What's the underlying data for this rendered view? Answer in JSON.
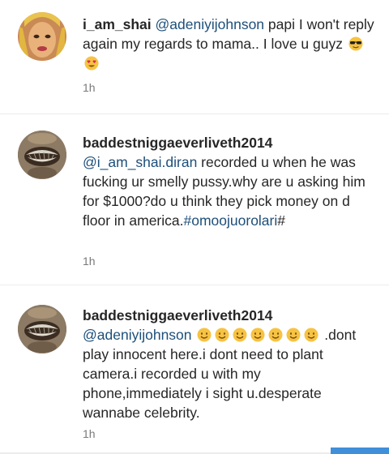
{
  "comments": [
    {
      "username": "i_am_shai",
      "mention": "@adeniyijohnson",
      "text": " papi I won't reply again my regards to mama.. I love u guyz ",
      "emojis": [
        "sunglasses-face-icon",
        "heart-eyes-face-icon"
      ],
      "time": "1h"
    },
    {
      "username": "baddestniggaeverliveth2014",
      "mention": "@i_am_shai.diran",
      "text": " recorded u when he was fucking ur smelly pussy.why are u asking him for $1000?do u think they pick money on d floor in america.",
      "hashtag": "#omoojuorolari",
      "tail": "#",
      "time": "1h"
    },
    {
      "username": "baddestniggaeverliveth2014",
      "mention": "@adeniyijohnson",
      "emojis": [
        "smiling-face-icon",
        "smiling-face-icon",
        "smiling-face-icon",
        "smiling-face-icon",
        "smiling-face-icon",
        "smiling-face-icon",
        "smiling-face-icon"
      ],
      "text": " .dont play innocent here.i dont need to plant camera.i recorded u with my phone,immediately i sight u.desperate wannabe celebrity.",
      "time": "1h"
    }
  ],
  "colors": {
    "mention": "#1d4f7a",
    "timestamp": "#7a7a7a",
    "accent": "#3f8fd9"
  }
}
